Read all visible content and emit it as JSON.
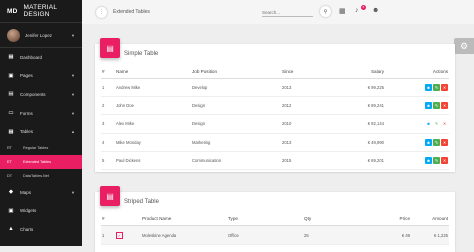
{
  "brand": {
    "abbr": "MD",
    "name": "MATERIAL DESIGN"
  },
  "user": {
    "name": "Jenifer Lopez"
  },
  "nav": [
    {
      "label": "Dashboard",
      "icon": "dashboard-icon",
      "glyph": "▦"
    },
    {
      "label": "Pages",
      "icon": "pages-icon",
      "glyph": "▣"
    },
    {
      "label": "Components",
      "icon": "components-icon",
      "glyph": "▤"
    },
    {
      "label": "Forms",
      "icon": "forms-icon",
      "glyph": "▭"
    },
    {
      "label": "Tables",
      "icon": "tables-icon",
      "glyph": "▦"
    },
    {
      "label": "Maps",
      "icon": "maps-icon",
      "glyph": "◆"
    },
    {
      "label": "Widgets",
      "icon": "widgets-icon",
      "glyph": "▣"
    },
    {
      "label": "Charts",
      "icon": "charts-icon",
      "glyph": "▲"
    }
  ],
  "subnav": [
    {
      "abbr": "RT",
      "label": "Regular Tables"
    },
    {
      "abbr": "ET",
      "label": "Extended Tables"
    },
    {
      "abbr": "DT",
      "label": "DataTables.Net"
    }
  ],
  "topbar": {
    "title": "Extended Tables",
    "search_placeholder": "Search...",
    "notification_count": "5"
  },
  "simple_table": {
    "title": "Simple Table",
    "headers": [
      "#",
      "Name",
      "Job Position",
      "Since",
      "Salary",
      "Actions"
    ],
    "rows": [
      [
        "1",
        "Andrew Mike",
        "Develop",
        "2013",
        "€ 99,225"
      ],
      [
        "2",
        "John Doe",
        "Design",
        "2012",
        "€ 89,241"
      ],
      [
        "3",
        "Alex Mike",
        "Design",
        "2010",
        "€ 92,144"
      ],
      [
        "4",
        "Mike Monday",
        "Marketing",
        "2013",
        "€ 49,990"
      ],
      [
        "5",
        "Paul Dickens",
        "Communication",
        "2015",
        "€ 69,201"
      ]
    ]
  },
  "striped_table": {
    "title": "Striped Table",
    "headers": [
      "#",
      "",
      "Product Name",
      "Type",
      "Qty",
      "Price",
      "Amount"
    ],
    "rows": [
      [
        "1",
        "",
        "Moleskine Agenda",
        "Office",
        "25",
        "€ 49",
        "€ 1,225"
      ]
    ]
  }
}
